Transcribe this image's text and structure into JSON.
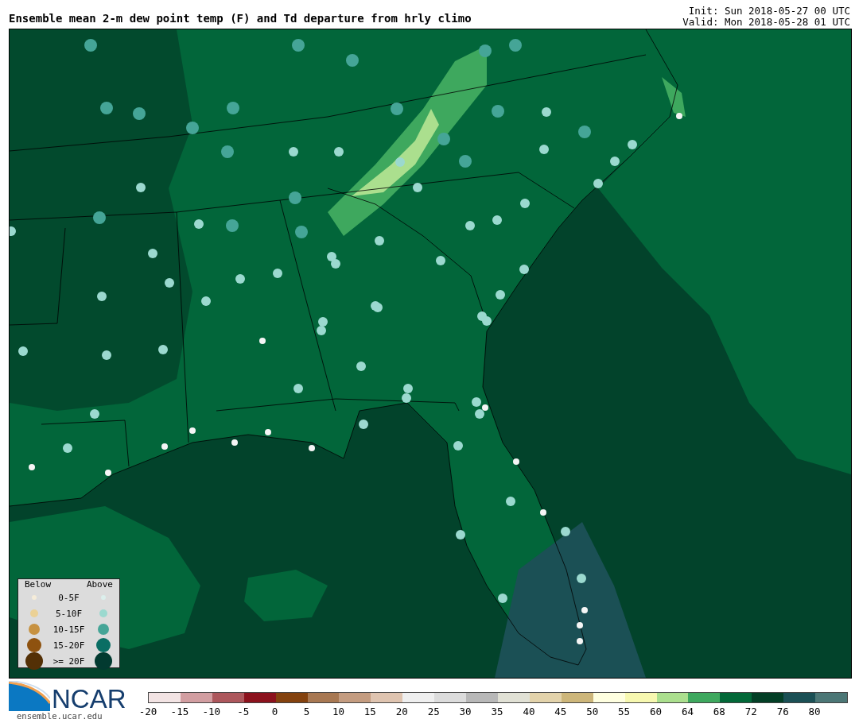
{
  "title": "Ensemble mean 2-m dew point temp (F) and Td departure from hrly climo",
  "init": "Init: Sun 2018-05-27 00 UTC",
  "valid": "Valid: Mon 2018-05-28 01 UTC",
  "legend": {
    "below_heading": "Below",
    "above_heading": "Above",
    "rows": [
      {
        "label": "0-5F",
        "below": {
          "color": "#f5ecd9"
        },
        "above": {
          "color": "#dcefec"
        }
      },
      {
        "label": "5-10F",
        "below": {
          "color": "#ebd195"
        },
        "above": {
          "color": "#9bd9cf"
        }
      },
      {
        "label": "10-15F",
        "below": {
          "color": "#c79241"
        },
        "above": {
          "color": "#45a597"
        }
      },
      {
        "label": "15-20F",
        "below": {
          "color": "#8e520f"
        },
        "above": {
          "color": "#0a6e64"
        }
      },
      {
        "label": ">= 20F",
        "below": {
          "color": "#533006"
        },
        "above": {
          "color": "#023a30"
        }
      }
    ]
  },
  "colorbar": {
    "segments": [
      {
        "color": "#f3e4e4"
      },
      {
        "color": "#d29ea1"
      },
      {
        "color": "#ad575c"
      },
      {
        "color": "#8c121d"
      },
      {
        "color": "#84420f"
      },
      {
        "color": "#a87852"
      },
      {
        "color": "#c49c80"
      },
      {
        "color": "#dfc4b0"
      },
      {
        "color": "#efefef"
      },
      {
        "color": "#dcdcdc"
      },
      {
        "color": "#b8b8b8"
      },
      {
        "color": "#e1e1d5"
      },
      {
        "color": "#e3d3ab"
      },
      {
        "color": "#cdb67a"
      },
      {
        "color": "#ffffe0"
      },
      {
        "color": "#f7f8b0"
      },
      {
        "color": "#abdf8e"
      },
      {
        "color": "#3ea85e"
      },
      {
        "color": "#026838"
      },
      {
        "color": "#033f26"
      },
      {
        "color": "#1b5055"
      },
      {
        "color": "#4c7776"
      }
    ],
    "ticks": [
      "-20",
      "-15",
      "-10",
      "-5",
      "0",
      "5",
      "10",
      "15",
      "20",
      "25",
      "30",
      "35",
      "40",
      "45",
      "50",
      "55",
      "60",
      "64",
      "68",
      "72",
      "76",
      "80"
    ]
  },
  "logo": {
    "name": "NCAR",
    "url": "ensemble.ucar.edu"
  }
}
